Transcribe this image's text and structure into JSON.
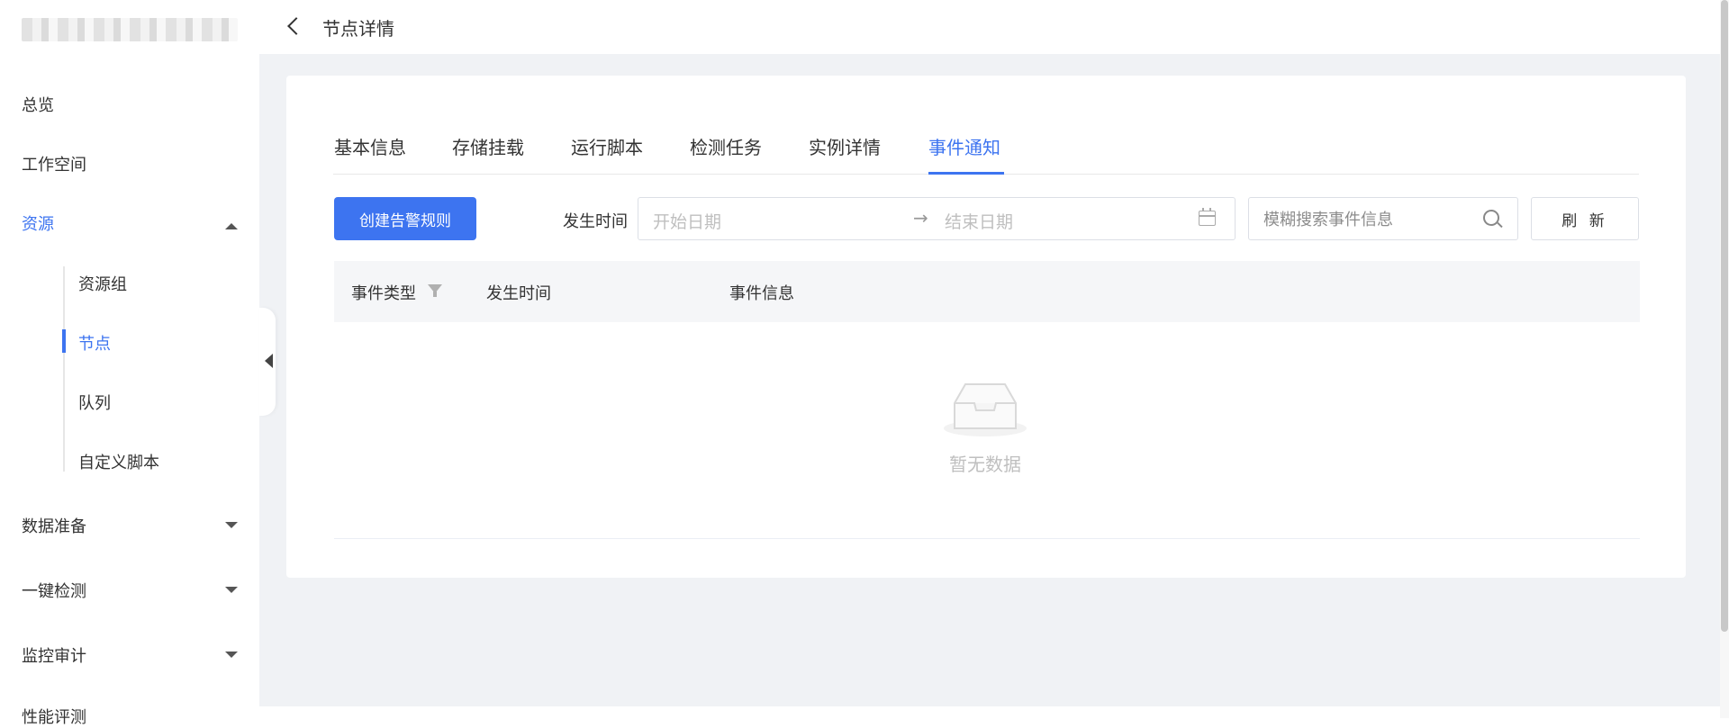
{
  "sidebar": {
    "items": [
      {
        "label": "总览"
      },
      {
        "label": "工作空间"
      },
      {
        "label": "资源"
      },
      {
        "label": "数据准备"
      },
      {
        "label": "一键检测"
      },
      {
        "label": "监控审计"
      },
      {
        "label": "性能评测"
      }
    ],
    "sub_items": [
      {
        "label": "资源组"
      },
      {
        "label": "节点"
      },
      {
        "label": "队列"
      },
      {
        "label": "自定义脚本"
      }
    ]
  },
  "header": {
    "title": "节点详情"
  },
  "tabs": [
    {
      "label": "基本信息"
    },
    {
      "label": "存储挂载"
    },
    {
      "label": "运行脚本"
    },
    {
      "label": "检测任务"
    },
    {
      "label": "实例详情"
    },
    {
      "label": "事件通知"
    }
  ],
  "toolbar": {
    "create_label": "创建告警规则",
    "time_label": "发生时间",
    "start_placeholder": "开始日期",
    "range_separator": "→",
    "end_placeholder": "结束日期",
    "search_placeholder": "模糊搜索事件信息",
    "refresh_label": "刷 新"
  },
  "table": {
    "columns": [
      {
        "label": "事件类型"
      },
      {
        "label": "发生时间"
      },
      {
        "label": "事件信息"
      }
    ],
    "empty_text": "暂无数据"
  },
  "colors": {
    "accent": "#3d74f0"
  }
}
